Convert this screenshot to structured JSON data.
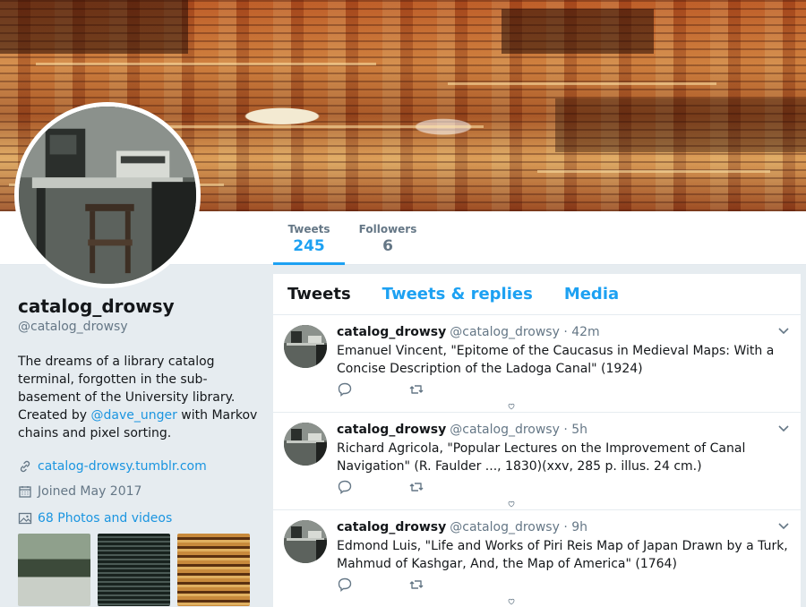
{
  "profile": {
    "name": "catalog_drowsy",
    "handle": "@catalog_drowsy",
    "bio_part1": "The dreams of a library catalog terminal, forgotten in the sub-basement of the University library. Created by ",
    "bio_mention": "@dave_unger",
    "bio_part2": " with Markov chains and pixel sorting.",
    "website": "catalog-drowsy.tumblr.com",
    "joined": "Joined May 2017",
    "photos_label": "68 Photos and videos"
  },
  "stats": [
    {
      "label": "Tweets",
      "value": "245"
    },
    {
      "label": "Followers",
      "value": "6"
    }
  ],
  "tabs": [
    "Tweets",
    "Tweets & replies",
    "Media"
  ],
  "tweets": [
    {
      "name": "catalog_drowsy",
      "meta": "@catalog_drowsy · 42m",
      "text": "Emanuel Vincent, \"Epitome of the Caucasus in Medieval Maps: With a Concise Description of the Ladoga Canal\" (1924)"
    },
    {
      "name": "catalog_drowsy",
      "meta": "@catalog_drowsy · 5h",
      "text": "Richard Agricola, \"Popular Lectures on the Improvement of Canal Navigation\" (R. Faulder ..., 1830)(xxv, 285 p. illus. 24 cm.)"
    },
    {
      "name": "catalog_drowsy",
      "meta": "@catalog_drowsy · 9h",
      "text": "Edmond Luis, \"Life and Works of Piri Reis Map of Japan Drawn by a Turk, Mahmud of Kashgar, And, the Map of America\" (1764)"
    }
  ],
  "colors": {
    "accent": "#1da1f2",
    "link": "#1b95e0",
    "muted": "#657786",
    "background": "#e6ecf0"
  },
  "icons": [
    "link-icon",
    "calendar-icon",
    "photo-icon",
    "reply-icon",
    "retweet-icon",
    "like-icon",
    "chevron-down-icon"
  ]
}
